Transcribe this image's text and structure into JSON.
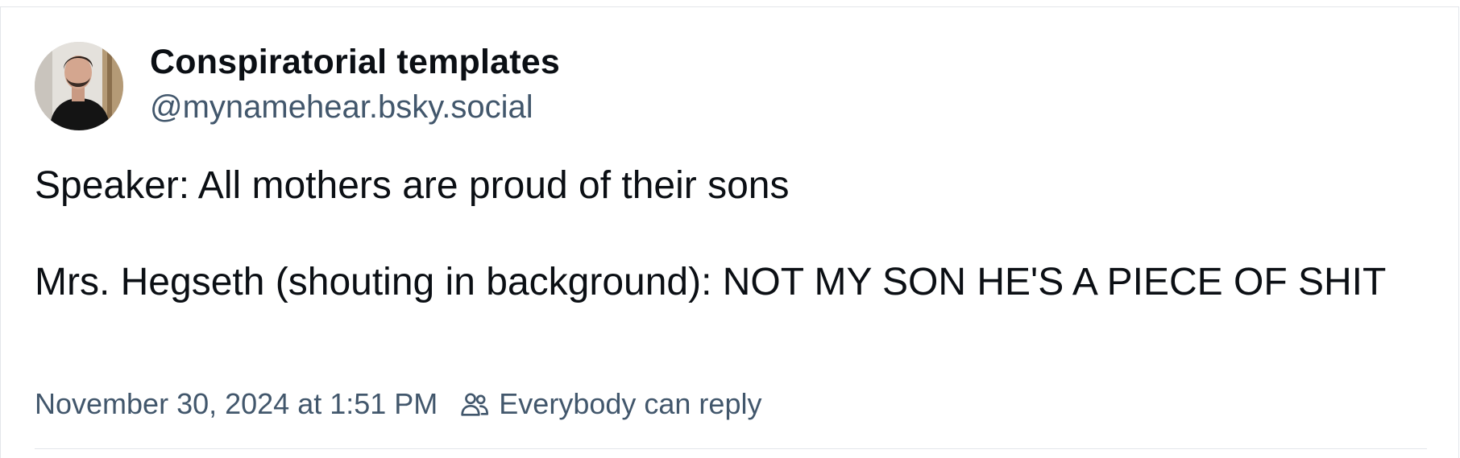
{
  "post": {
    "author": {
      "display_name": "Conspiratorial templates",
      "handle": "@mynamehear.bsky.social"
    },
    "text_paragraphs": [
      "Speaker: All mothers are proud of their sons",
      "Mrs. Hegseth (shouting in background): NOT MY SON HE'S A PIECE OF SHIT"
    ],
    "timestamp": "November 30, 2024 at 1:51 PM",
    "reply_setting": {
      "icon": "people-icon",
      "label": "Everybody can reply"
    }
  },
  "colors": {
    "text_primary": "#0b0f14",
    "text_secondary": "#42576c",
    "border": "#e3e6ea",
    "background": "#ffffff"
  }
}
